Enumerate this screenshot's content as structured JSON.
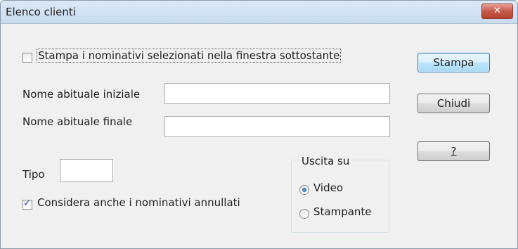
{
  "window": {
    "title": "Elenco clienti",
    "close_label": "✕"
  },
  "options": {
    "print_selected_label": "Stampa i nominativi selezionati nella finestra sottostante",
    "print_selected_checked": false,
    "include_cancelled_label": "Considera anche i nominativi annullati",
    "include_cancelled_checked": true
  },
  "fields": {
    "start_name_label": "Nome abituale iniziale",
    "start_name_value": "",
    "end_name_label": "Nome abituale finale",
    "end_name_value": "",
    "type_label": "Tipo",
    "type_value": ""
  },
  "output": {
    "legend": "Uscita su",
    "options": [
      "Video",
      "Stampante"
    ],
    "selected": "Video"
  },
  "buttons": {
    "print": "Stampa",
    "close": "Chiudi",
    "help": "?"
  }
}
